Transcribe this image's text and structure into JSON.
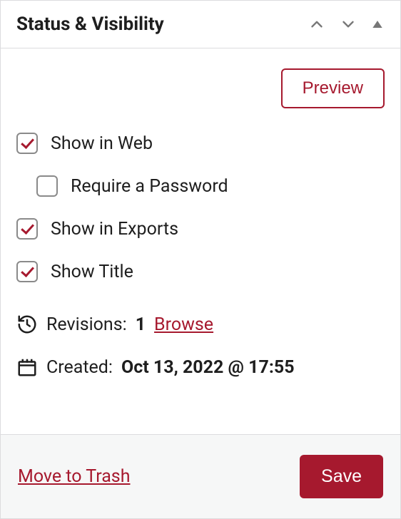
{
  "header": {
    "title": "Status & Visibility"
  },
  "actions": {
    "preview": "Preview"
  },
  "options": {
    "show_in_web": {
      "label": "Show in Web",
      "checked": true
    },
    "require_password": {
      "label": "Require a Password",
      "checked": false
    },
    "show_in_exports": {
      "label": "Show in Exports",
      "checked": true
    },
    "show_title": {
      "label": "Show Title",
      "checked": true
    }
  },
  "meta": {
    "revisions_label": "Revisions:",
    "revisions_count": "1",
    "browse": "Browse",
    "created_label": "Created:",
    "created_value": "Oct 13, 2022 @ 17:55"
  },
  "footer": {
    "trash": "Move to Trash",
    "save": "Save"
  }
}
